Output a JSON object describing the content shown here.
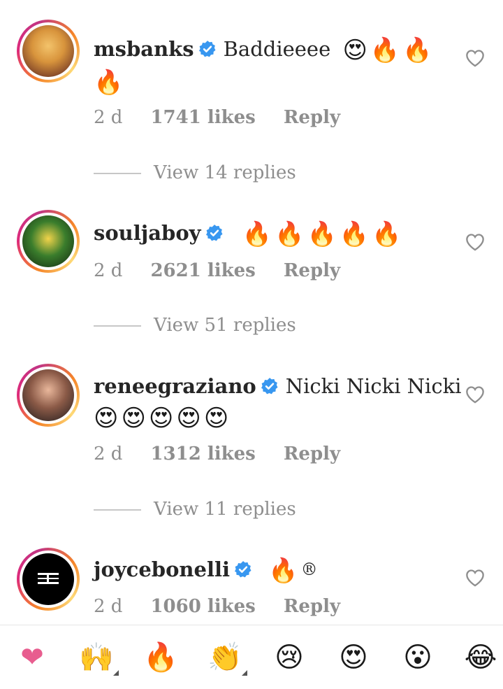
{
  "comments": [
    {
      "username": "msbanks",
      "verified": true,
      "text": "Baddieeee",
      "emojis_line1": [
        "😍",
        "🔥",
        "🔥"
      ],
      "emojis_line2": [
        "🔥"
      ],
      "time": "2 d",
      "likes": "1741 likes",
      "reply": "Reply",
      "view_replies": "View 14 replies"
    },
    {
      "username": "souljaboy",
      "verified": true,
      "text": "",
      "emojis_line1": [
        "🔥",
        "🔥",
        "🔥",
        "🔥",
        "🔥"
      ],
      "time": "2 d",
      "likes": "2621 likes",
      "reply": "Reply",
      "view_replies": "View 51 replies"
    },
    {
      "username": "reneegraziano",
      "verified": true,
      "text": "Nicki Nicki Nicki",
      "emojis_line2": [
        "😍",
        "😍",
        "😍",
        "😍",
        "😍"
      ],
      "time": "2 d",
      "likes": "1312 likes",
      "reply": "Reply",
      "view_replies": "View 11 replies"
    },
    {
      "username": "joycebonelli",
      "verified": true,
      "text": "®",
      "emojis_line1": [
        "🔥"
      ],
      "time": "2 d",
      "likes": "1060 likes",
      "reply": "Reply"
    }
  ],
  "emoji_bar": [
    "❤",
    "🙌",
    "🔥",
    "👏",
    "😢",
    "😍",
    "😮",
    "😂"
  ],
  "colors": {
    "verified": "#3897f0",
    "meta_text": "#8e8e8e",
    "heart": "#e85d8f"
  }
}
